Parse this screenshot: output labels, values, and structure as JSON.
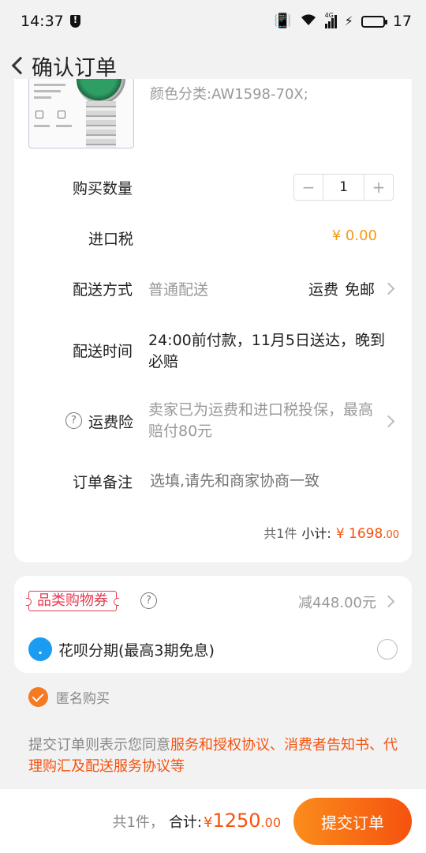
{
  "status_bar": {
    "time": "14:37",
    "battery_level": "17",
    "network_label": "4G",
    "icons": [
      "shield-alert-icon",
      "vibrate-icon",
      "wifi-icon",
      "signal-icon",
      "charging-icon",
      "battery-icon"
    ]
  },
  "nav": {
    "title": "确认订单",
    "back_icon": "chevron-left-icon"
  },
  "product": {
    "variant": "颜色分类:AW1598-70X;"
  },
  "order": {
    "quantity_label": "购买数量",
    "quantity_minus": "−",
    "quantity_value": "1",
    "quantity_plus": "+",
    "import_tax_label": "进口税",
    "import_tax_value": "¥ 0.00",
    "delivery_method_label": "配送方式",
    "delivery_method_value": "普通配送",
    "shipping_fee_label": "运费",
    "shipping_fee_value": "免邮",
    "delivery_time_label": "配送时间",
    "delivery_time_value": "24:00前付款，11月5日送达，晚到必赔",
    "shipping_insurance_label": "运费险",
    "shipping_insurance_value": "卖家已为运费和进口税投保，最高赔付80元",
    "remark_label": "订单备注",
    "remark_placeholder": "选填,请先和商家协商一致",
    "subtotal_count": "共1件",
    "subtotal_label": "小计:",
    "subtotal_currency": "¥",
    "subtotal_int": "1698",
    "subtotal_dec": ".00"
  },
  "promo": {
    "coupon_label": "品类购物券",
    "coupon_discount": "减448.00元",
    "huabei_label": "花呗分期(最高3期免息)"
  },
  "anonymous_label": "匿名购买",
  "agreement": {
    "prefix": "提交订单则表示您同意",
    "links": "服务和授权协议、消费者告知书、代理购汇及配送服务协议等"
  },
  "footer": {
    "count": "共1件，",
    "total_label": "合计:",
    "total_currency": "¥",
    "total_int": "1250",
    "total_dec": ".00",
    "submit_label": "提交订单"
  },
  "colors": {
    "accent": "#f5520e",
    "price_orange": "#f39c12",
    "coupon_red": "#e8384f",
    "huabei_blue": "#1a9cf0"
  }
}
